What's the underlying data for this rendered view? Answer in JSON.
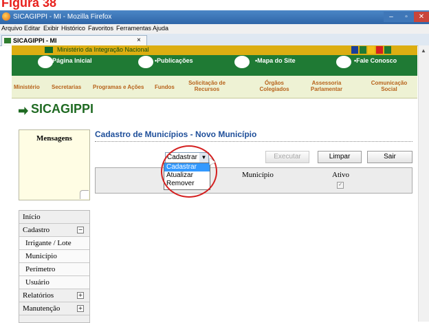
{
  "caption": "Figura 38",
  "window": {
    "title": "SICAGIPPI - MI - Mozilla Firefox"
  },
  "menubar": [
    "Arquivo",
    "Editar",
    "Exibir",
    "Histórico",
    "Favoritos",
    "Ferramentas",
    "Ajuda"
  ],
  "tab": {
    "label": "SICAGIPPI - MI",
    "close": "×"
  },
  "site": {
    "ministry": "Ministério da Integração Nacional",
    "nav": [
      "•Página Inicial",
      "•Publicações",
      "•Mapa do Site",
      "•Fale Conosco"
    ],
    "menu": [
      "Ministério",
      "Secretarias",
      "Programas e Ações",
      "Fundos",
      "Solicitação de\nRecursos",
      "Órgãos\nColegiados",
      "Assessoria\nParlamentar",
      "Comunicação\nSocial"
    ]
  },
  "app_title": "SICAGIPPI",
  "messages_title": "Mensagens",
  "sidebar": [
    {
      "label": "Início"
    },
    {
      "label": "Cadastro",
      "expander": "−"
    },
    {
      "label": "Irrigante / Lote"
    },
    {
      "label": "Município"
    },
    {
      "label": "Perímetro"
    },
    {
      "label": "Usuário"
    },
    {
      "label": "Relatórios",
      "expander": "+"
    },
    {
      "label": "Manutenção",
      "expander": "+"
    }
  ],
  "main": {
    "title": "Cadastro de Municípios - Novo Município",
    "action_select": {
      "value": "Cadastrar",
      "options": [
        "Cadastrar",
        "Atualizar",
        "Remover"
      ],
      "highlighted": "Cadastrar"
    },
    "buttons": {
      "execute": "Executar",
      "clear": "Limpar",
      "exit": "Sair"
    },
    "columns": [
      "Município",
      "Ativo"
    ],
    "checkbox_mark": "✓"
  }
}
